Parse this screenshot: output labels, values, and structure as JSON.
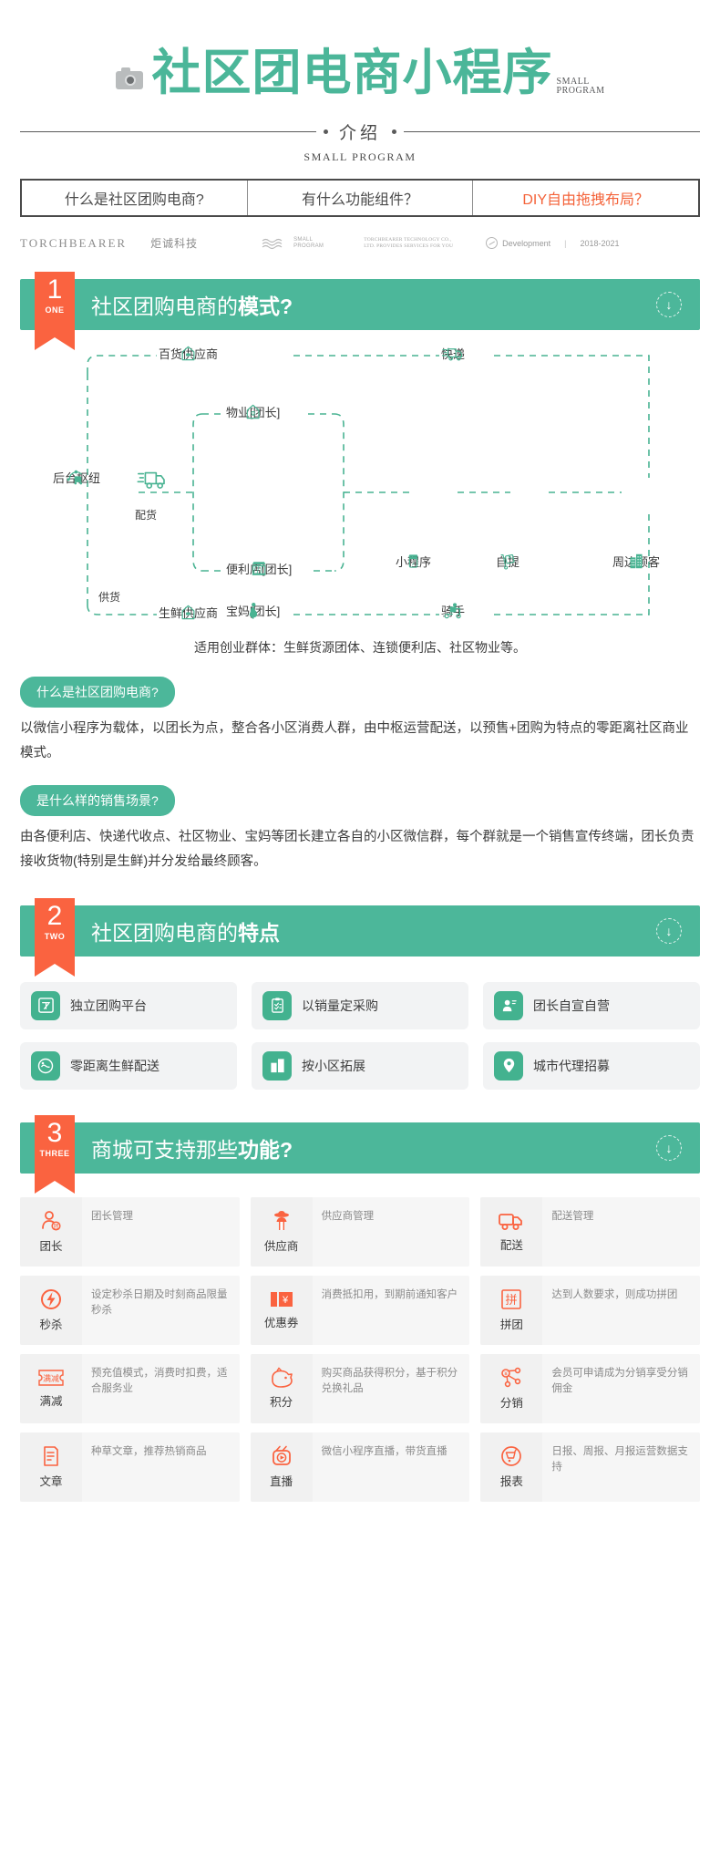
{
  "header": {
    "title": "社区团电商小程序",
    "title_superscript_line1": "SMALL",
    "title_superscript_line2": "PROGRAM",
    "divider_label": "介绍",
    "subtitle_en": "SMALL PROGRAM"
  },
  "questions": [
    {
      "text": "什么是社区团购电商?",
      "accent": false
    },
    {
      "text": "有什么功能组件？",
      "accent": false
    },
    {
      "text": "DIY自由拖拽布局？",
      "accent": true
    }
  ],
  "brandbar": {
    "brand_en": "TORCHBEARER",
    "brand_cn": "炬诚科技",
    "wave_line1": "SMALL",
    "wave_line2": "PROGRAM",
    "legal_line1": "TORCHBEARER TECHNOLOGY CO.,",
    "legal_line2": "LTD. PROVIDES SERVICES FOR YOU",
    "development": "Development",
    "separator": "|",
    "years": "2018-2021"
  },
  "sections": [
    {
      "number": "1",
      "en": "ONE",
      "title_light": "社区团购电商的",
      "title_bold": "模式?",
      "arrow": "↓"
    },
    {
      "number": "2",
      "en": "TWO",
      "title_light": "社区团购电商的",
      "title_bold": "特点",
      "arrow": "↓"
    },
    {
      "number": "3",
      "en": "THREE",
      "title_light": "商城可支持那些",
      "title_bold": "功能?",
      "arrow": "↓"
    }
  ],
  "flow": {
    "nodes": [
      {
        "key": "dept_supplier",
        "label": "百货供应商",
        "icon": "house-icon"
      },
      {
        "key": "express",
        "label": "快递",
        "icon": "truck-icon"
      },
      {
        "key": "property",
        "label": "物业[团长]",
        "icon": "house-heart-icon"
      },
      {
        "key": "hub",
        "label": "后台枢纽",
        "icon": "hub-truck-icon"
      },
      {
        "key": "convenience",
        "label": "便利店[团长]",
        "icon": "shop-icon"
      },
      {
        "key": "miniprogram",
        "label": "小程序",
        "icon": "phone-shop-icon"
      },
      {
        "key": "selfpickup",
        "label": "自提",
        "icon": "cart-box-icon"
      },
      {
        "key": "neighbors",
        "label": "周边顾客",
        "icon": "building-icon"
      },
      {
        "key": "mom",
        "label": "宝妈[团长]",
        "icon": "pregnant-icon"
      },
      {
        "key": "fresh_supplier",
        "label": "生鲜供应商",
        "icon": "store-icon"
      },
      {
        "key": "rider",
        "label": "骑手",
        "icon": "scooter-icon"
      }
    ],
    "edge_labels": [
      {
        "key": "distribute",
        "label": "配货"
      },
      {
        "key": "supply",
        "label": "供货"
      }
    ],
    "caption": "适用创业群体：生鲜货源团体、连锁便利店、社区物业等。"
  },
  "qa": [
    {
      "pill": "什么是社区团购电商?",
      "body": "以微信小程序为载体，以团长为点，整合各小区消费人群，由中枢运营配送，以预售+团购为特点的零距离社区商业模式。"
    },
    {
      "pill": "是什么样的销售场景?",
      "body": "由各便利店、快递代收点、社区物业、宝妈等团长建立各自的小区微信群，每个群就是一个销售宣传终端，团长负责接收货物(特别是生鲜)并分发给最终顾客。"
    }
  ],
  "features": [
    {
      "label": "独立团购平台",
      "icon": "group-square-icon"
    },
    {
      "label": "以销量定采购",
      "icon": "clipboard-check-icon"
    },
    {
      "label": "团长自宣自营",
      "icon": "user-card-icon"
    },
    {
      "label": "零距离生鲜配送",
      "icon": "delivery-hand-icon"
    },
    {
      "label": "按小区拓展",
      "icon": "building-icon"
    },
    {
      "label": "城市代理招募",
      "icon": "location-user-icon"
    }
  ],
  "functions": [
    {
      "name": "团长",
      "icon": "user-tag-icon",
      "desc": "团长管理"
    },
    {
      "name": "供应商",
      "icon": "farmer-icon",
      "desc": "供应商管理"
    },
    {
      "name": "配送",
      "icon": "truck-icon",
      "desc": "配送管理"
    },
    {
      "name": "秒杀",
      "icon": "flash-icon",
      "desc": "设定秒杀日期及时刻商品限量秒杀"
    },
    {
      "name": "优惠券",
      "icon": "coupon-icon",
      "desc": "消费抵扣用，到期前通知客户"
    },
    {
      "name": "拼团",
      "icon": "pin-square-icon",
      "desc": "达到人数要求，则成功拼团"
    },
    {
      "name": "满减",
      "icon": "manjian-icon",
      "desc": "预充值模式，消费时扣费，适合服务业"
    },
    {
      "name": "积分",
      "icon": "piggy-icon",
      "desc": "购买商品获得积分，基于积分兑换礼品"
    },
    {
      "name": "分销",
      "icon": "share-icon",
      "desc": "会员可申请成为分销享受分销佣金"
    },
    {
      "name": "文章",
      "icon": "document-icon",
      "desc": "种草文章，推荐热销商品"
    },
    {
      "name": "直播",
      "icon": "live-icon",
      "desc": "微信小程序直播，带货直播"
    },
    {
      "name": "报表",
      "icon": "report-icon",
      "desc": "日报、周报、月报运营数据支持"
    }
  ],
  "colors": {
    "green": "#4cb79a",
    "green_dark": "#38a887",
    "orange": "#fa6340",
    "gray_card": "#f2f3f4"
  }
}
